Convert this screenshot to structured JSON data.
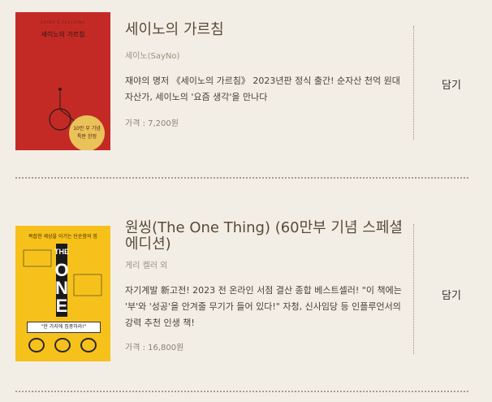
{
  "books": [
    {
      "title": "세이노의 가르침",
      "author": "세이노(SayNo)",
      "description": "재야의 명저 《세이노의 가르침》 2023년판 정식 출간! 순자산 천억 원대 자산가, 세이노의 '요즘 생각'을 만나다",
      "price": "가격 : 7,200원",
      "add_label": "담기",
      "cover": {
        "subtitle": "SAYNO'S TEACHING",
        "title": "세이노의 가르침",
        "badge_line1": "10만 부 기념",
        "badge_line2": "특판 한정"
      }
    },
    {
      "title": "원씽(The One Thing) (60만부 기념 스페셜 에디션)",
      "author": "게리 켈러 외",
      "description": "자기계발 新고전! 2023 전 온라인 서점 결산 종합 베스트셀러! \"이 책에는 '부'와 '성공'을 안겨줄 무기가 들어 있다!\" 자청, 신사임당 등 인플루언서의 강력 추천 인생 책!",
      "price": "가격 : 16,800원",
      "add_label": "담기",
      "cover": {
        "top_text": "복잡한 세상을 이기는 단순함의 힘",
        "big": "ONE",
        "ribbon": "\"한 가지에 집중하라!\""
      }
    }
  ],
  "colors": {
    "background": "#f3eee5",
    "title": "#5a4a38",
    "cover1": "#c42a25",
    "cover2": "#f6c11b"
  }
}
